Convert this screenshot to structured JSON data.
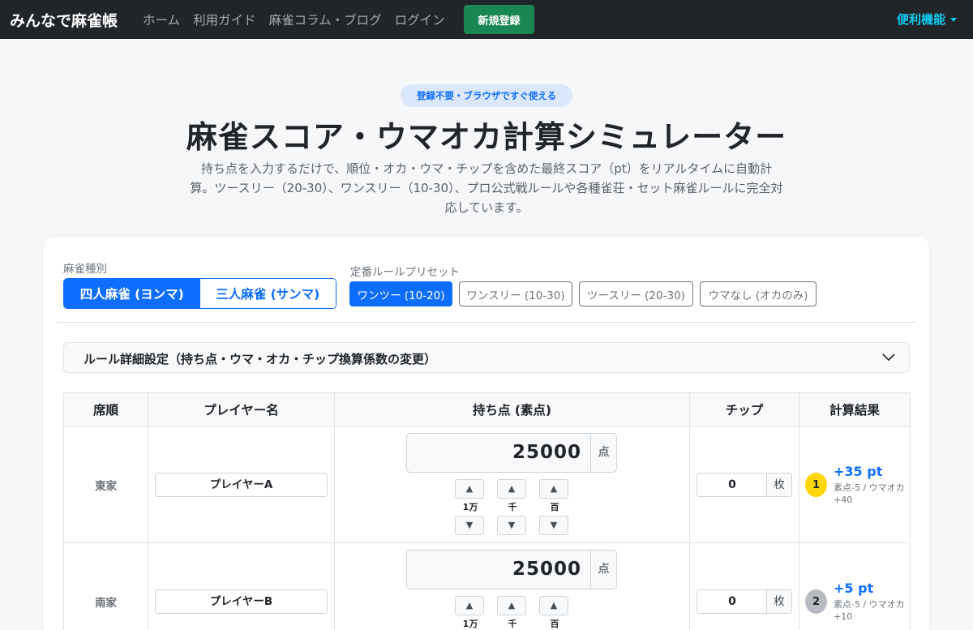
{
  "nav": {
    "brand": "みんなで麻雀帳",
    "links": [
      "ホーム",
      "利用ガイド",
      "麻雀コラム・ブログ",
      "ログイン"
    ],
    "signup": "新規登録",
    "tools": "便利機能"
  },
  "hero": {
    "badge": "登録不要・ブラウザですぐ使える",
    "title": "麻雀スコア・ウマオカ計算シミュレーター",
    "description": "持ち点を入力するだけで、順位・オカ・ウマ・チップを含めた最終スコア（pt）をリアルタイムに自動計算。ツースリー（20-30）、ワンスリー（10-30）、プロ公式戦ルールや各種雀荘・セット麻雀ルールに完全対応しています。"
  },
  "settings": {
    "mode_label": "麻雀種別",
    "modes": [
      "四人麻雀 (ヨンマ)",
      "三人麻雀 (サンマ)"
    ],
    "preset_label": "定番ルールプリセット",
    "presets": [
      "ワンツー (10-20)",
      "ワンスリー (10-30)",
      "ツースリー (20-30)",
      "ウマなし (オカのみ)"
    ],
    "accordion": "ルール詳細設定（持ち点・ウマ・オカ・チップ換算係数の変更）"
  },
  "table": {
    "headers": [
      "席順",
      "プレイヤー名",
      "持ち点 (素点)",
      "チップ",
      "計算結果"
    ],
    "point_unit": "点",
    "chip_unit": "枚",
    "step_labels": [
      "1万",
      "千",
      "百"
    ],
    "up": "▲",
    "down": "▼",
    "rows": [
      {
        "seat": "東家",
        "name": "プレイヤーA",
        "score": "25000",
        "chips": "0",
        "rank": "1",
        "rank_color": "#ffd60a",
        "result": "+35 pt",
        "detail": "素点-5 / ウマオカ+40"
      },
      {
        "seat": "南家",
        "name": "プレイヤーB",
        "score": "25000",
        "chips": "0",
        "rank": "2",
        "rank_color": "#b8bcc2",
        "result": "+5 pt",
        "detail": "素点-5 / ウマオカ+10"
      }
    ]
  }
}
